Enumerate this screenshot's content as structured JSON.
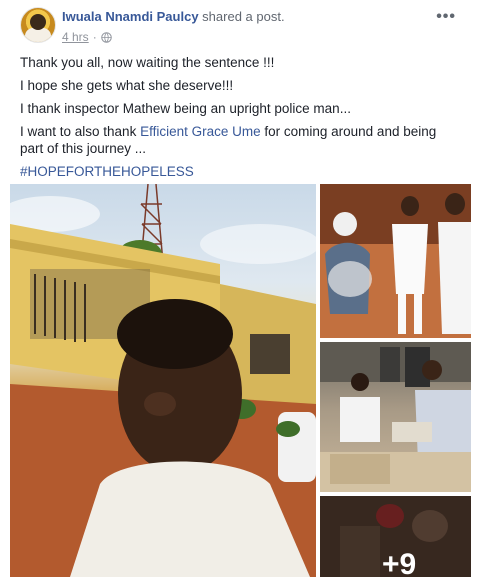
{
  "post": {
    "author": "Iwuala Nnamdi Paulcy",
    "action": "shared a post.",
    "time": "4 hrs",
    "paragraphs": [
      "Thank you all, now waiting the sentence !!!",
      "I hope she gets what she deserve!!!",
      "I thank inspector Mathew being an upright police man..."
    ],
    "thanks_prefix": "I want to also thank ",
    "tagged_name": "Efficient Grace Ume",
    "thanks_suffix": " for coming around and being part of this journey ...",
    "hashtag": "#HOPEFORTHEHOPELESS",
    "more_photos": "+9"
  },
  "icons": {
    "globe": "globe-icon",
    "more": "more-options-icon"
  },
  "colors": {
    "link": "#385898",
    "meta": "#90949c",
    "text": "#1d2129"
  }
}
